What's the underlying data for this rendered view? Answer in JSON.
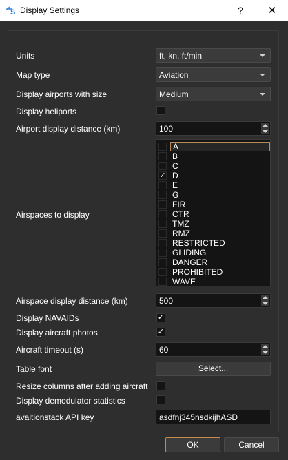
{
  "window": {
    "title": "Display Settings",
    "help": "?",
    "close": "✕",
    "app_icon": "app-logo-icon"
  },
  "settings": {
    "units": {
      "label": "Units",
      "value": "ft, kn, ft/min"
    },
    "map_type": {
      "label": "Map type",
      "value": "Aviation"
    },
    "airport_size": {
      "label": "Display airports with size",
      "value": "Medium"
    },
    "heliports": {
      "label": "Display heliports",
      "checked": false,
      "mark": ""
    },
    "airport_distance": {
      "label": "Airport display distance (km)",
      "value": "100"
    },
    "airspaces": {
      "label": "Airspaces to display",
      "items": [
        {
          "label": "A",
          "checked": false,
          "mark": ""
        },
        {
          "label": "B",
          "checked": false,
          "mark": ""
        },
        {
          "label": "C",
          "checked": false,
          "mark": ""
        },
        {
          "label": "D",
          "checked": true,
          "mark": "✓"
        },
        {
          "label": "E",
          "checked": false,
          "mark": ""
        },
        {
          "label": "G",
          "checked": false,
          "mark": ""
        },
        {
          "label": "FIR",
          "checked": false,
          "mark": ""
        },
        {
          "label": "CTR",
          "checked": false,
          "mark": ""
        },
        {
          "label": "TMZ",
          "checked": false,
          "mark": ""
        },
        {
          "label": "RMZ",
          "checked": false,
          "mark": ""
        },
        {
          "label": "RESTRICTED",
          "checked": false,
          "mark": ""
        },
        {
          "label": "GLIDING",
          "checked": false,
          "mark": ""
        },
        {
          "label": "DANGER",
          "checked": false,
          "mark": ""
        },
        {
          "label": "PROHIBITED",
          "checked": false,
          "mark": ""
        },
        {
          "label": "WAVE",
          "checked": false,
          "mark": ""
        }
      ]
    },
    "airspace_distance": {
      "label": "Airspace display distance (km)",
      "value": "500"
    },
    "navaids": {
      "label": "Display NAVAIDs",
      "checked": true,
      "mark": "✓"
    },
    "aircraft_photos": {
      "label": "Display aircraft photos",
      "checked": true,
      "mark": "✓"
    },
    "aircraft_timeout": {
      "label": "Aircraft timeout (s)",
      "value": "60"
    },
    "table_font": {
      "label": "Table font",
      "button": "Select..."
    },
    "resize_columns": {
      "label": "Resize columns after adding aircraft",
      "checked": false,
      "mark": ""
    },
    "demod_stats": {
      "label": "Display demodulator statistics",
      "checked": false,
      "mark": ""
    },
    "api_key": {
      "label": "avaitionstack API key",
      "value": "asdfnj345nsdkijhASD"
    }
  },
  "buttons": {
    "ok": "OK",
    "cancel": "Cancel"
  },
  "colors": {
    "accent": "#c68a4e",
    "background": "#2e2e2e"
  }
}
